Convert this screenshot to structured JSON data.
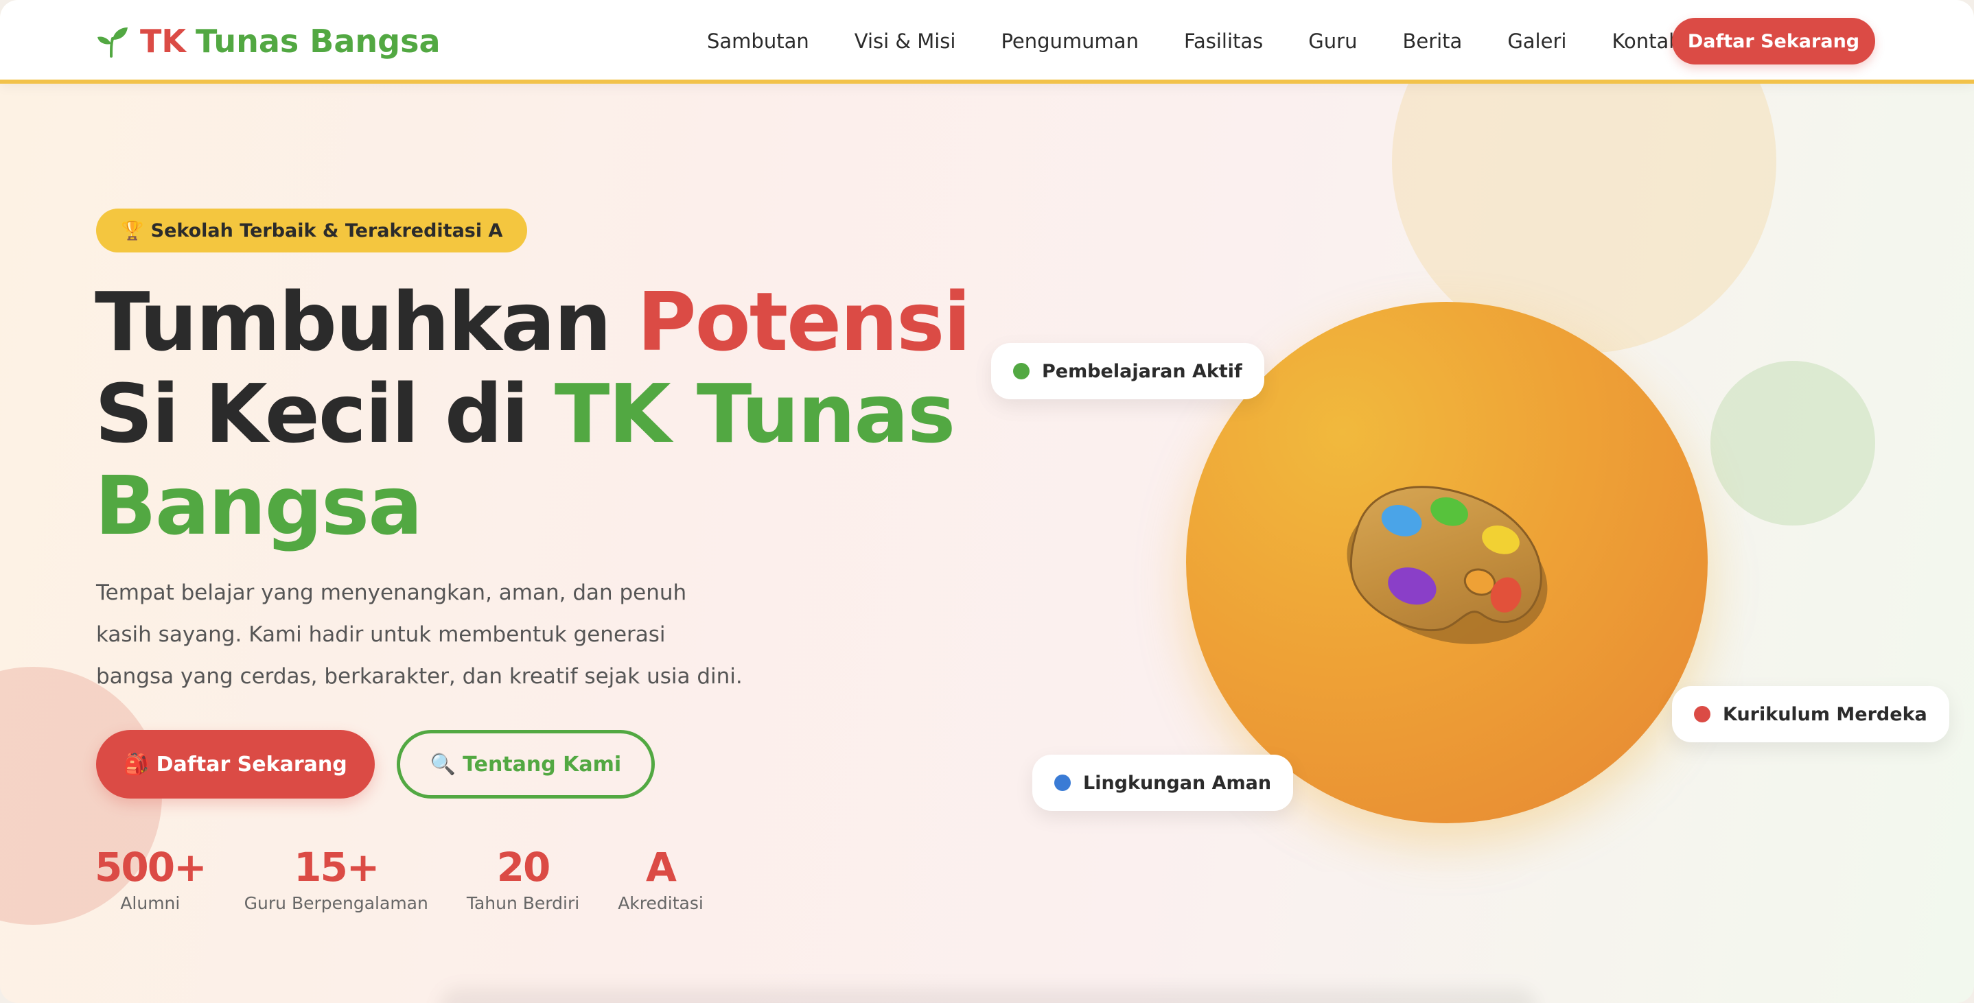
{
  "brand": {
    "name_part1": "TK",
    "name_part2": "Tunas Bangsa",
    "logo_icon": "sprout-icon"
  },
  "nav": {
    "items": [
      "Sambutan",
      "Visi & Misi",
      "Pengumuman",
      "Fasilitas",
      "Guru",
      "Berita",
      "Galeri",
      "Kontak"
    ],
    "cta_label": "Daftar Sekarang"
  },
  "hero": {
    "badge": {
      "icon": "🏆",
      "text": "Sekolah Terbaik & Terakreditasi A"
    },
    "title": {
      "part1": "Tumbuhkan ",
      "part2_red": "Potensi",
      "part3": " Si Kecil di ",
      "part4_green": "TK Tunas Bangsa"
    },
    "description": "Tempat belajar yang menyenangkan, aman, dan penuh kasih sayang. Kami hadir untuk membentuk generasi bangsa yang cerdas, berkarakter, dan kreatif sejak usia dini.",
    "primary_button": {
      "icon": "🎒",
      "label": "Daftar Sekarang"
    },
    "secondary_button": {
      "icon": "🔍",
      "label": "Tentang Kami"
    },
    "stats": [
      {
        "value": "500+",
        "label": "Alumni"
      },
      {
        "value": "15+",
        "label": "Guru Berpengalaman"
      },
      {
        "value": "20",
        "label": "Tahun Berdiri"
      },
      {
        "value": "A",
        "label": "Akreditasi"
      }
    ],
    "feature_pills": [
      {
        "label": "Pembelajaran Aktif",
        "dot_color": "#52a842"
      },
      {
        "label": "Kurikulum Merdeka",
        "dot_color": "#db4b45"
      },
      {
        "label": "Lingkungan Aman",
        "dot_color": "#3a7bd5"
      }
    ],
    "illustration": "paint-palette-icon"
  },
  "colors": {
    "primary_red": "#db4b45",
    "primary_green": "#52a842",
    "accent_yellow": "#f4c63f",
    "orb_orange": "#eea136"
  }
}
